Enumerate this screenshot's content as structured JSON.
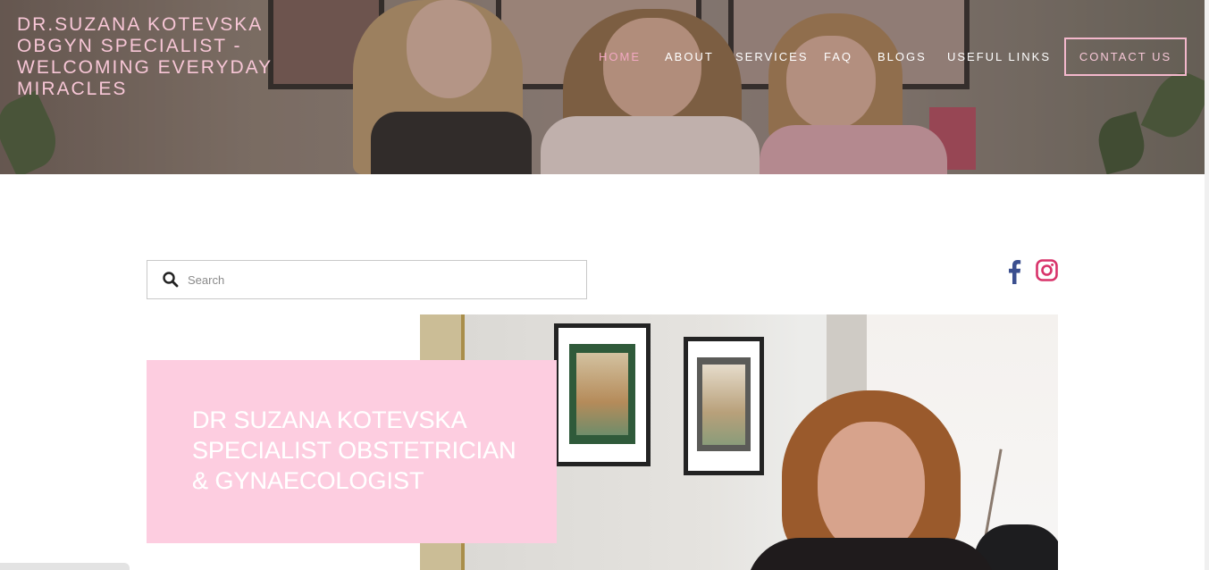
{
  "header": {
    "brand_lines": [
      "DR.SUZANA KOTEVSKA",
      "OBGYN SPECIALIST -",
      "WELCOMING EVERYDAY",
      "MIRACLES"
    ],
    "nav": {
      "home": "HOME",
      "about": "ABOUT",
      "services": "SERVICES",
      "faq": "FAQ",
      "blogs": "BLOGS",
      "useful_links": "USEFUL LINKS"
    },
    "active_nav": "home",
    "contact_label": "CONTACT US"
  },
  "search": {
    "placeholder": "Search",
    "value": ""
  },
  "social": {
    "facebook_icon": "facebook-icon",
    "instagram_icon": "instagram-icon"
  },
  "hero_card": {
    "lines": [
      "DR SUZANA KOTEVSKA",
      "SPECIALIST OBSTETRICIAN",
      "& GYNAECOLOGIST"
    ]
  },
  "colors": {
    "brand_pink": "#f7c6d6",
    "active_nav": "#f2a8c2",
    "card_bg": "#fdcde0",
    "facebook_blue": "#3b4f8f",
    "instagram_pink": "#d8336a"
  }
}
